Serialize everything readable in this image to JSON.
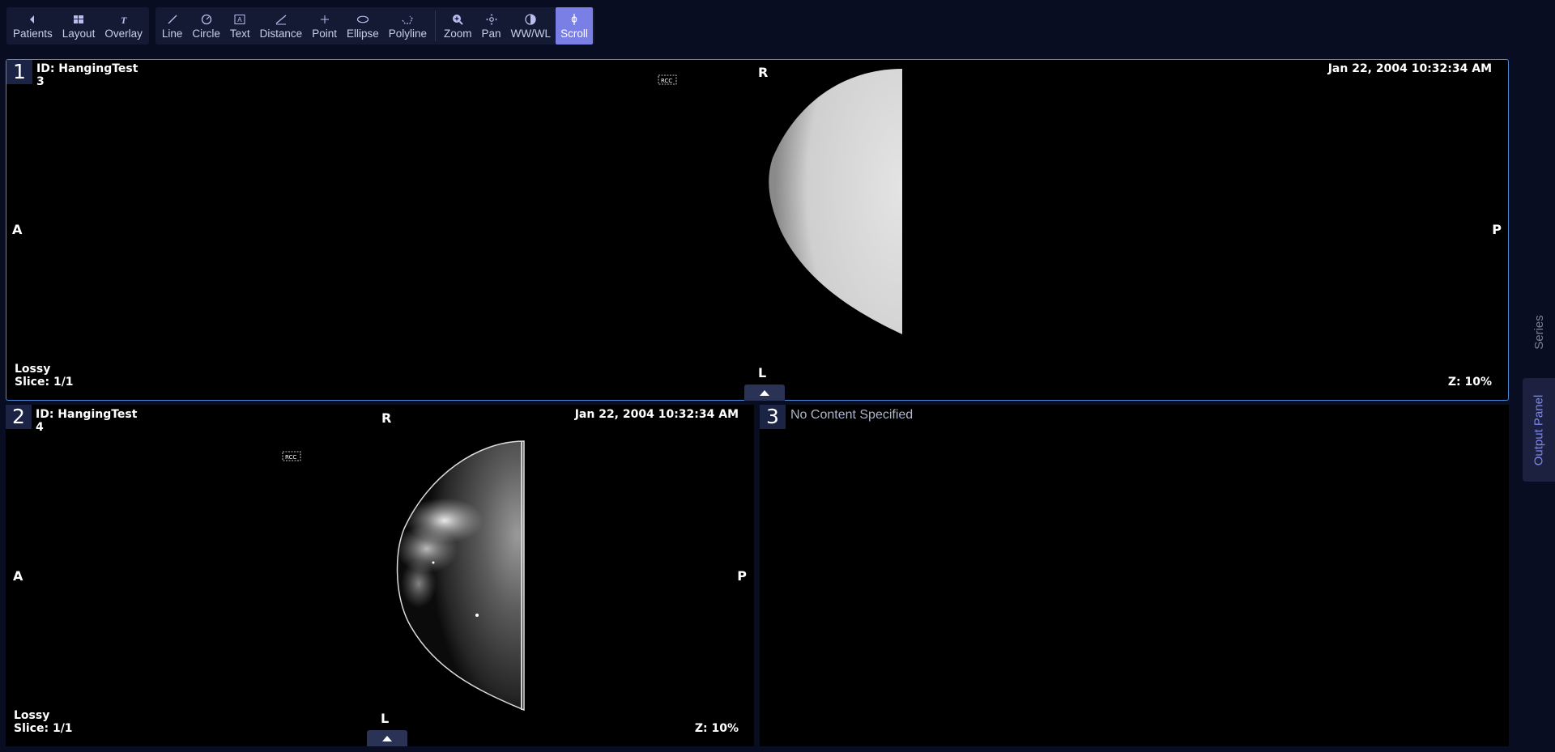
{
  "toolbar": {
    "groups": [
      [
        {
          "label": "Patients",
          "icon": "chevron-left-icon"
        },
        {
          "label": "Layout",
          "icon": "layout-icon"
        },
        {
          "label": "Overlay",
          "icon": "overlay-icon"
        }
      ],
      [
        {
          "label": "Line",
          "icon": "line-icon"
        },
        {
          "label": "Circle",
          "icon": "circle-icon"
        },
        {
          "label": "Text",
          "icon": "text-icon"
        },
        {
          "label": "Distance",
          "icon": "distance-icon"
        },
        {
          "label": "Point",
          "icon": "point-icon"
        },
        {
          "label": "Ellipse",
          "icon": "ellipse-icon"
        },
        {
          "label": "Polyline",
          "icon": "polyline-icon"
        }
      ],
      [
        {
          "label": "Zoom",
          "icon": "zoom-icon"
        },
        {
          "label": "Pan",
          "icon": "pan-icon"
        },
        {
          "label": "WW/WL",
          "icon": "contrast-icon"
        },
        {
          "label": "Scroll",
          "icon": "scroll-icon",
          "active": true
        }
      ]
    ]
  },
  "viewports": [
    {
      "number": "1",
      "patient_id": "ID: HangingTest",
      "series": "3",
      "datetime": "Jan 22, 2004 10:32:34 AM",
      "orient_top": "R",
      "orient_bottom": "L",
      "orient_left": "A",
      "orient_right": "P",
      "compression": "Lossy",
      "slice": "Slice: 1/1",
      "zoom": "Z: 10%"
    },
    {
      "number": "2",
      "patient_id": "ID: HangingTest",
      "series": "4",
      "datetime": "Jan 22, 2004 10:32:34 AM",
      "orient_top": "R",
      "orient_bottom": "L",
      "orient_left": "A",
      "orient_right": "P",
      "compression": "Lossy",
      "slice": "Slice: 1/1",
      "zoom": "Z: 10%"
    },
    {
      "number": "3",
      "message": "No Content Specified"
    }
  ],
  "side_panel": {
    "series_label": "Series",
    "output_label": "Output Panel"
  },
  "colors": {
    "background": "#080d21",
    "accent": "#7a7fe6",
    "selected_border": "#4c8ad8"
  }
}
